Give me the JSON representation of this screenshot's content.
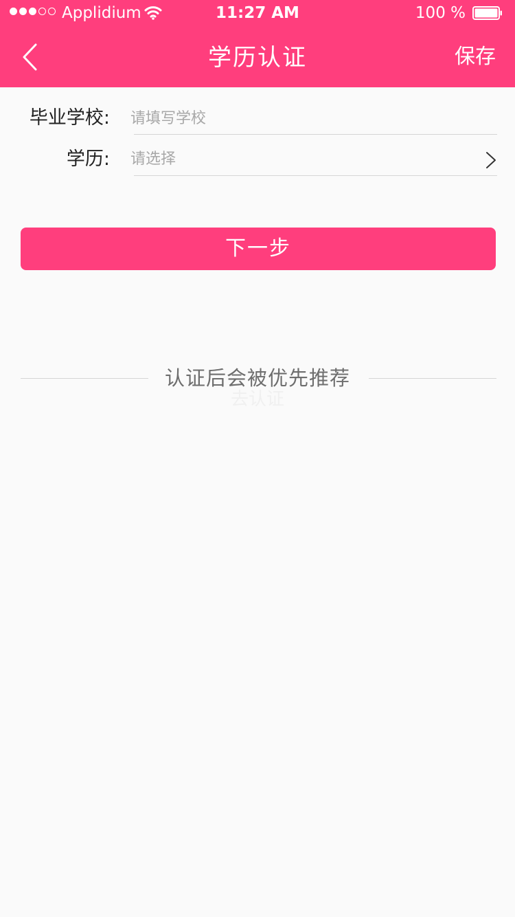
{
  "status_bar": {
    "carrier": "Applidium",
    "time": "11:27 AM",
    "battery": "100 %",
    "signal_bars_filled": 3,
    "signal_bars_total": 5
  },
  "nav": {
    "title": "学历认证",
    "save_label": "保存"
  },
  "form": {
    "school_label": "毕业学校:",
    "school_placeholder": "请填写学校",
    "school_value": "",
    "education_label": "学历:",
    "education_placeholder": "请选择"
  },
  "actions": {
    "next_label": "下一步"
  },
  "footer": {
    "recommend_text": "认证后会被优先推荐",
    "go_verify_label": "去认证"
  },
  "colors": {
    "brand": "#ff3e7d",
    "background": "#fafafa",
    "placeholder": "#a8a8a8",
    "divider": "#d5d5d5"
  }
}
